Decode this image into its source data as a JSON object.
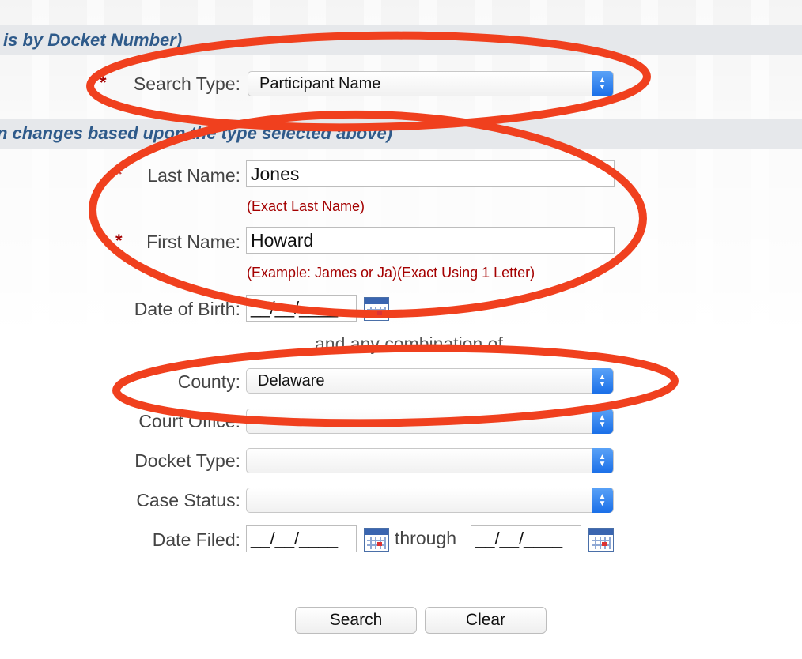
{
  "bands": {
    "top_text": "is by Docket Number)",
    "middle_text": "n changes based upon the type selected above)"
  },
  "search_type": {
    "required_mark": "*",
    "label": "Search Type:",
    "value": "Participant Name"
  },
  "last_name": {
    "required_mark": "*",
    "label": "Last Name:",
    "value": "Jones",
    "hint": "(Exact Last Name)"
  },
  "first_name": {
    "required_mark": "*",
    "label": "First Name:",
    "value": "Howard",
    "hint": "(Example: James or Ja)(Exact Using 1 Letter)"
  },
  "date_of_birth": {
    "label": "Date of Birth:",
    "value": "__/__/____"
  },
  "combination_text": "and any combination of",
  "county": {
    "label": "County:",
    "value": "Delaware"
  },
  "court_office": {
    "label": "Court Office:",
    "value": ""
  },
  "docket_type": {
    "label": "Docket Type:",
    "value": ""
  },
  "case_status": {
    "label": "Case Status:",
    "value": ""
  },
  "date_filed": {
    "label": "Date Filed:",
    "from_value": "__/__/____",
    "through_label": "through",
    "to_value": "__/__/____"
  },
  "buttons": {
    "search": "Search",
    "clear": "Clear"
  },
  "colors": {
    "annotation": "#f0401e",
    "band_text": "#2e5a8a",
    "required": "#a40000",
    "hint": "#a40000",
    "stepper": "#1a6fe8"
  },
  "icons": {
    "calendar": "calendar-icon",
    "stepper": "chevron-up-down-icon"
  }
}
